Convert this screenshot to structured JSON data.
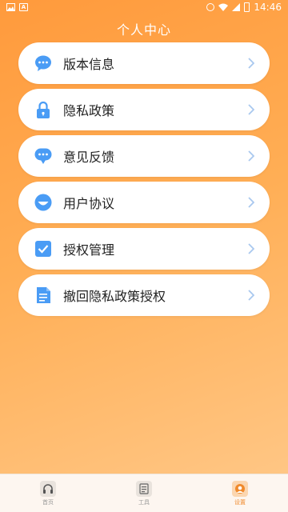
{
  "status_bar": {
    "left_icons": [
      "image-icon",
      "a-box-icon"
    ],
    "time": "14:46",
    "right_icons": [
      "dnd-icon",
      "wifi-icon",
      "signal-icon",
      "battery-icon"
    ]
  },
  "page": {
    "title": "个人中心"
  },
  "menu": {
    "items": [
      {
        "label": "版本信息",
        "icon": "chat-dots-icon"
      },
      {
        "label": "隐私政策",
        "icon": "lock-icon"
      },
      {
        "label": "意见反馈",
        "icon": "message-icon"
      },
      {
        "label": "用户协议",
        "icon": "smile-icon"
      },
      {
        "label": "授权管理",
        "icon": "check-box-icon"
      },
      {
        "label": "撤回隐私政策授权",
        "icon": "document-icon"
      }
    ]
  },
  "tab_bar": {
    "tabs": [
      {
        "label": "首页",
        "icon": "headphones-icon",
        "active": false
      },
      {
        "label": "工具",
        "icon": "tools-icon",
        "active": false
      },
      {
        "label": "设置",
        "icon": "profile-icon",
        "active": true
      }
    ]
  },
  "colors": {
    "accent": "#f08a2c",
    "icon_blue": "#4a9cf5",
    "chevron": "#a9c8ef"
  }
}
